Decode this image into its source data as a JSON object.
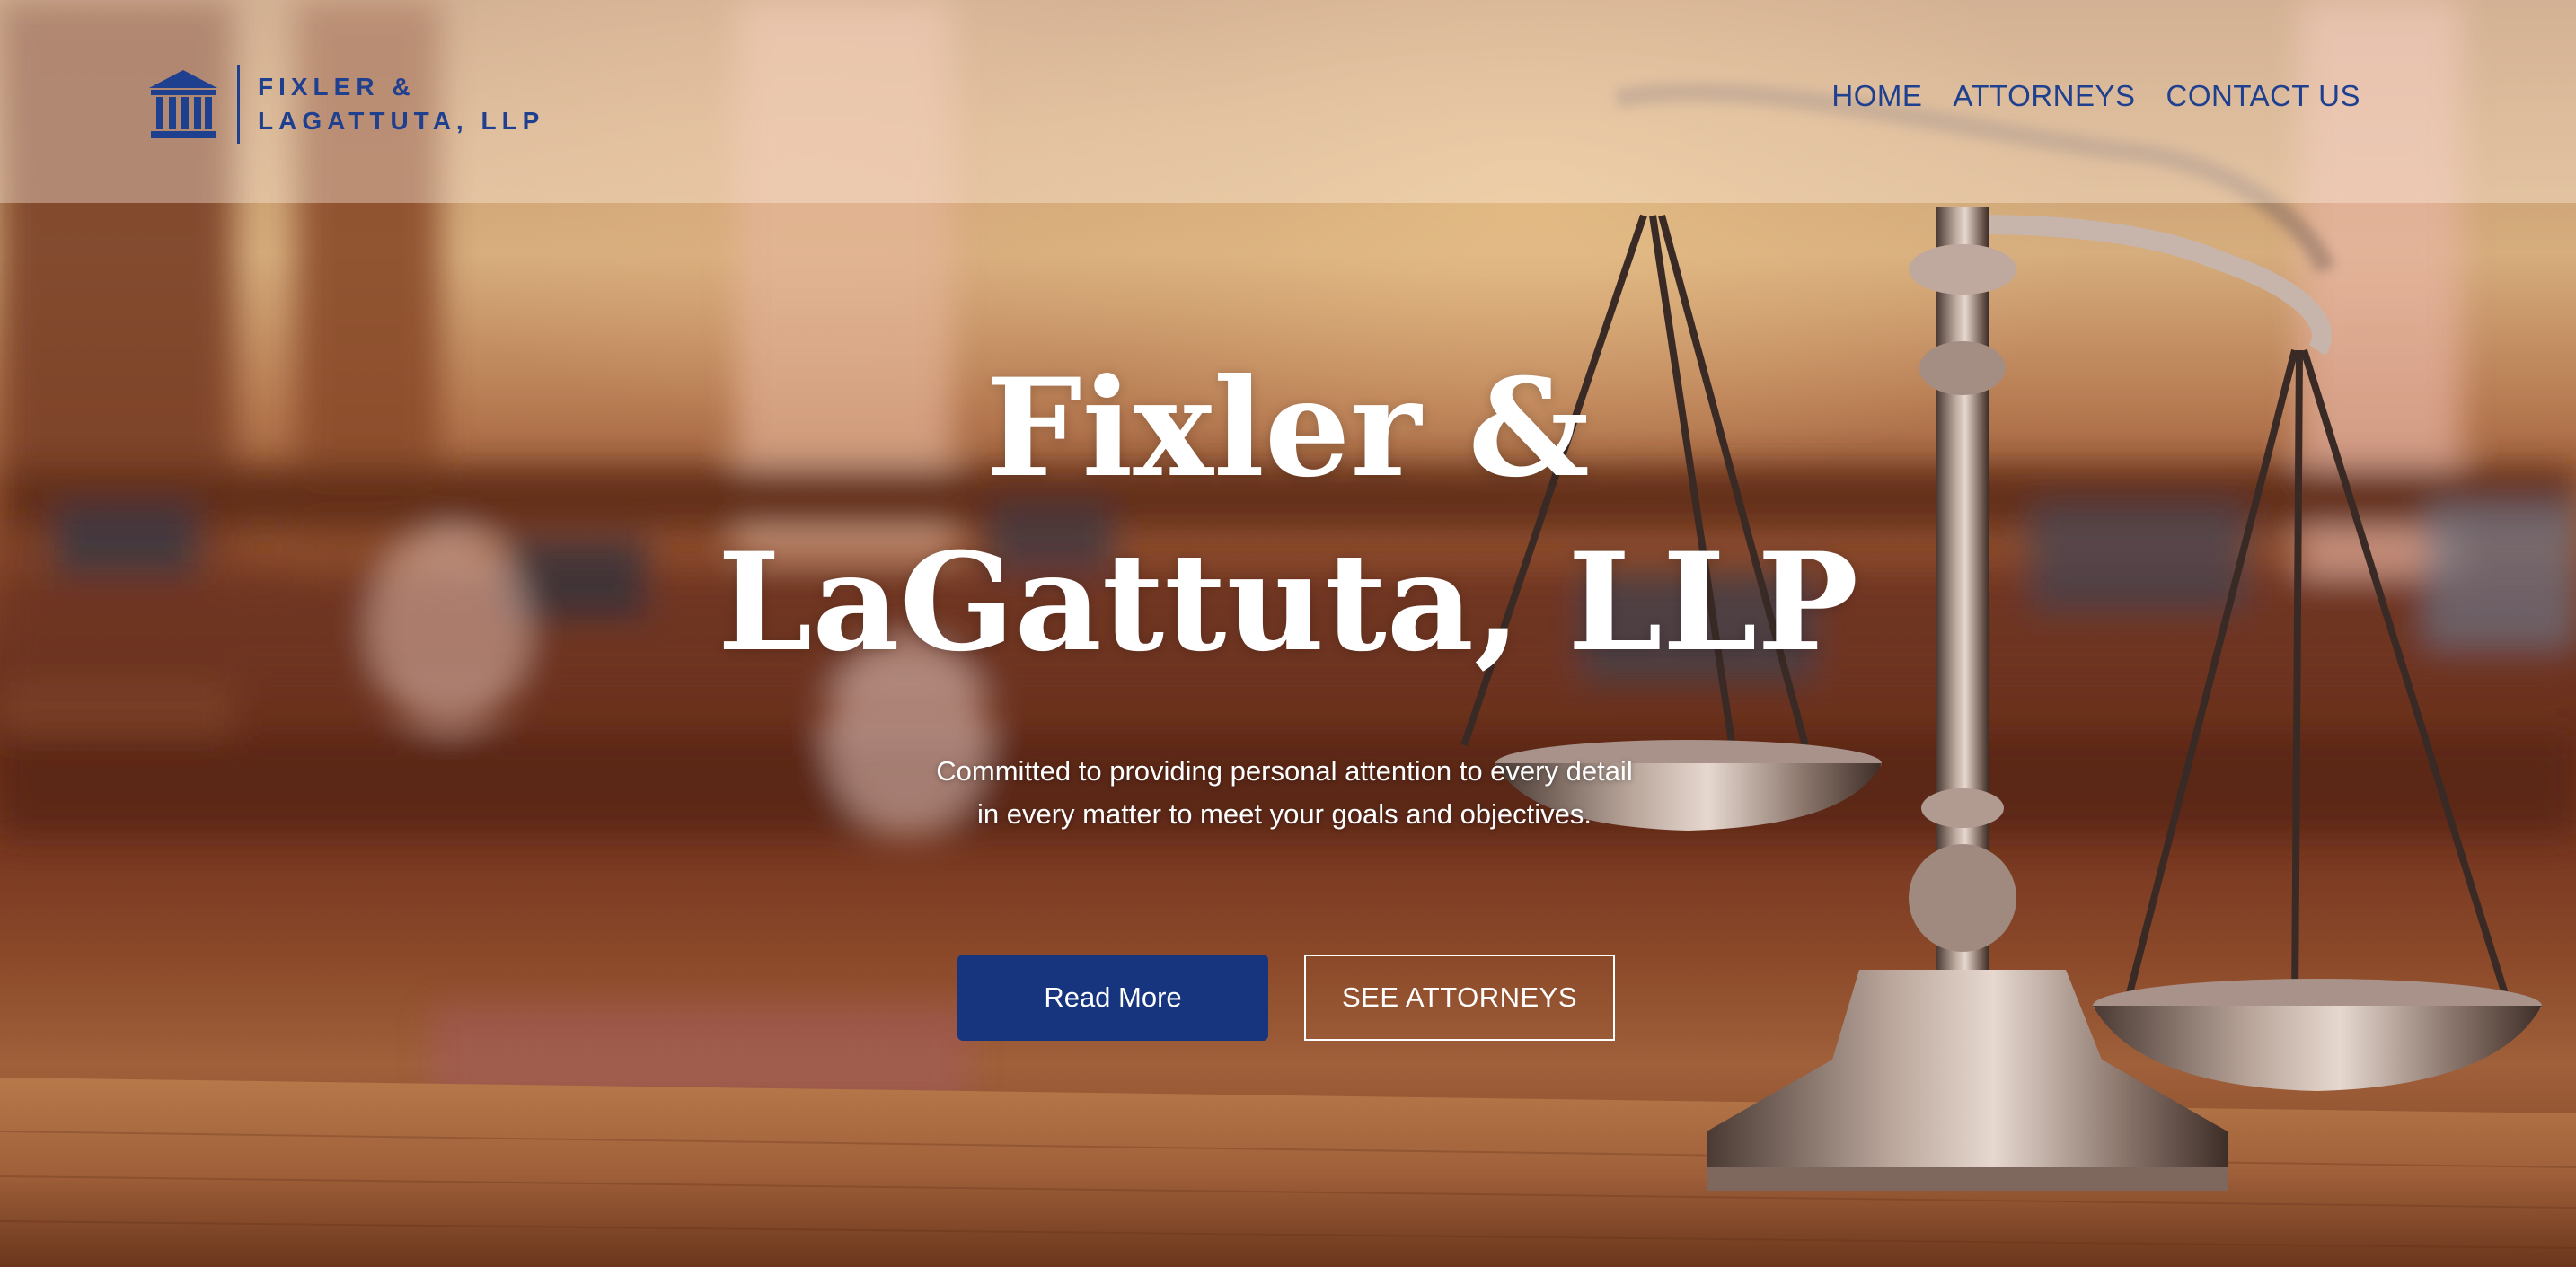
{
  "brand": {
    "name_line1": "FIXLER &",
    "name_line2": "LAGATTUTA, LLP",
    "icon": "courthouse-icon",
    "color": "#1f3f8f"
  },
  "nav": {
    "items": [
      {
        "label": "HOME"
      },
      {
        "label": "ATTORNEYS"
      },
      {
        "label": "CONTACT US"
      }
    ]
  },
  "hero": {
    "title": "Fixler & LaGattuta, LLP",
    "subtitle": "Committed to providing personal attention to every detail in every matter to meet your goals and objectives.",
    "primary_button": "Read More",
    "secondary_button": "SEE ATTORNEYS",
    "background_image": "scales-of-justice-icon"
  },
  "colors": {
    "primary_button": "#17357f",
    "text_on_image": "#ffffff"
  }
}
